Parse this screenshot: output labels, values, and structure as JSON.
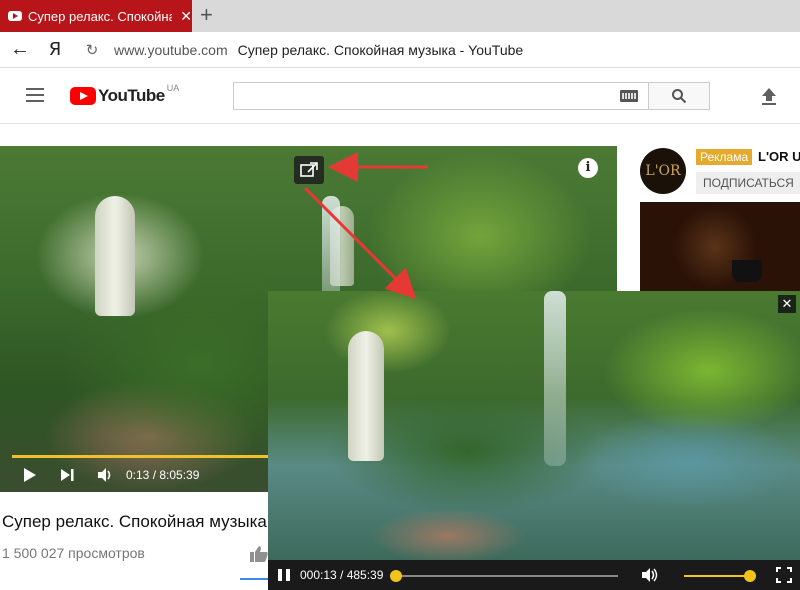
{
  "browser": {
    "tab_title": "Супер релакс. Спокойная м",
    "tab_close": "✕",
    "new_tab": "+",
    "back": "←",
    "yandex": "Я",
    "reload": "↻",
    "url_host": "www.youtube.com",
    "url_title": "Супер релакс. Спокойная музыка - YouTube"
  },
  "youtube": {
    "logo_word": "YouTube",
    "logo_region": "UA",
    "search_placeholder": ""
  },
  "player": {
    "info": "i",
    "time": "0:13 / 8:05:39",
    "progress_fraction": 0.0004
  },
  "video": {
    "title": "Супер релакс. Спокойная музыка",
    "views": "1 500 027 просмотров"
  },
  "ad": {
    "logo_text": "L'OR",
    "badge": "Реклама",
    "name": "L'OR U",
    "subscribe": "ПОДПИСАТЬСЯ"
  },
  "pip": {
    "close": "✕",
    "time": "000:13 / 485:39",
    "progress_fraction": 0.0004,
    "volume_fraction": 1.0
  },
  "colors": {
    "tab_red": "#b8151b",
    "youtube_red": "#ff0000",
    "progress_yellow": "#f0c12c",
    "ad_badge": "#e5a92e",
    "arrow_red": "#e53935"
  }
}
